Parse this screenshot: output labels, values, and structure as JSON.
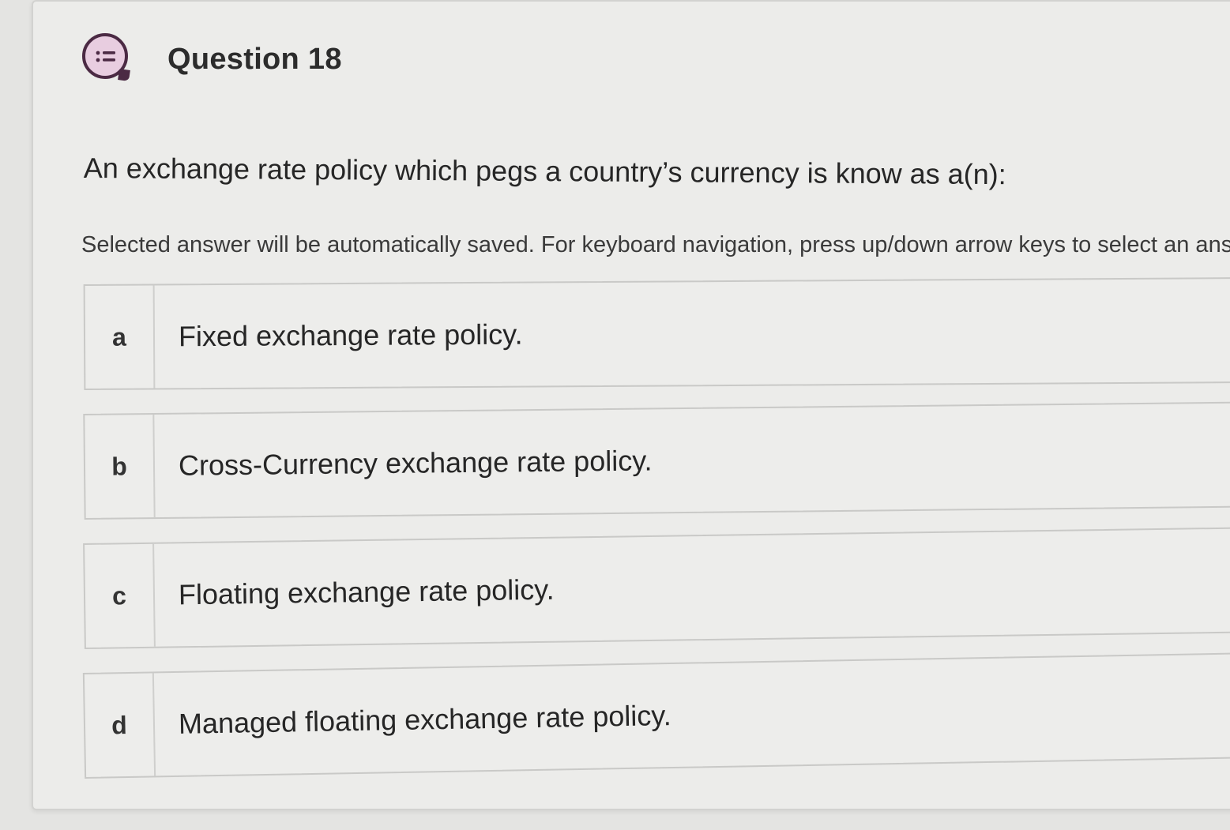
{
  "question": {
    "icon": "list-bubble-icon",
    "title": "Question 18",
    "text": "An exchange rate policy which pegs a country’s currency is know as a(n):",
    "instructions": "Selected answer will be automatically saved. For keyboard navigation, press up/down arrow keys to select an answ"
  },
  "options": [
    {
      "letter": "a",
      "text": "Fixed exchange rate policy."
    },
    {
      "letter": "b",
      "text": "Cross-Currency exchange rate policy."
    },
    {
      "letter": "c",
      "text": "Floating exchange rate policy."
    },
    {
      "letter": "d",
      "text": "Managed floating exchange rate policy."
    }
  ],
  "colors": {
    "icon_fill": "#e8cde0",
    "icon_stroke": "#4b2a44"
  }
}
